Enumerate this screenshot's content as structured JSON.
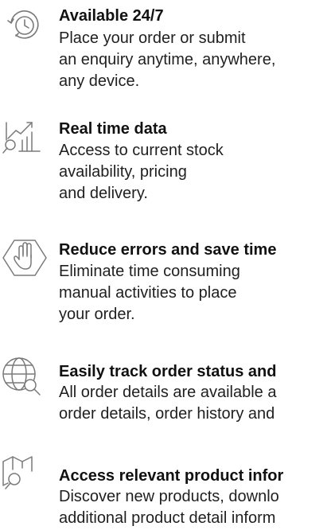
{
  "features": [
    {
      "icon": "clock-refresh-icon",
      "title": "Available 24/7",
      "lines": [
        "Place your order or submit",
        "an enquiry anytime, anywhere,",
        "any device."
      ]
    },
    {
      "icon": "chart-search-icon",
      "title": "Real time data",
      "lines": [
        "Access to current stock",
        "availability, pricing",
        "and delivery."
      ]
    },
    {
      "icon": "stop-hand-icon",
      "title": "Reduce errors and save time",
      "lines": [
        "Eliminate time consuming",
        "manual activities to place",
        "your order."
      ]
    },
    {
      "icon": "globe-search-icon",
      "title": "Easily track order status and",
      "lines": [
        "All order details are available a",
        "order details, order history and"
      ]
    },
    {
      "icon": "map-search-icon",
      "title": "Access relevant product infor",
      "lines": [
        "Discover new products, downlo",
        "additional product detail inform"
      ]
    }
  ],
  "colors": {
    "text": "#1a1a1a",
    "icon_stroke": "#7a7a7a"
  }
}
